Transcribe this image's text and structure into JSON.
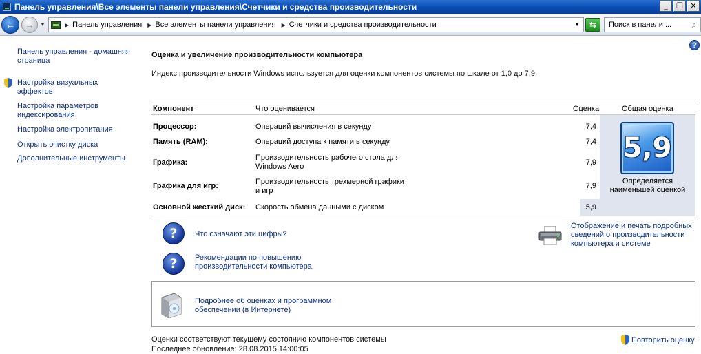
{
  "window": {
    "title": "Панель управления\\Все элементы панели управления\\Счетчики и средства производительности",
    "buttons": {
      "minimize": "_",
      "maximize": "❐",
      "close": "✕"
    }
  },
  "address": {
    "crumbs": [
      "Панель управления",
      "Все элементы панели управления",
      "Счетчики и средства производительности"
    ],
    "search_placeholder": "Поиск в панели ..."
  },
  "sidebar": {
    "items": [
      {
        "label": "Панель управления - домашняя страница",
        "shield": false
      },
      {
        "label": "Настройка визуальных эффектов",
        "shield": true
      },
      {
        "label": "Настройка параметров индексирования",
        "shield": false
      },
      {
        "label": "Настройка электропитания",
        "shield": false
      },
      {
        "label": "Открыть очистку диска",
        "shield": false
      },
      {
        "label": "Дополнительные инструменты",
        "shield": false
      }
    ]
  },
  "main": {
    "title": "Оценка и увеличение производительности компьютера",
    "intro": "Индекс производительности Windows используется для оценки компонентов системы по шкале от 1,0 до 7,9.",
    "table": {
      "headers": {
        "component": "Компонент",
        "what": "Что оценивается",
        "score": "Оценка",
        "base": "Общая оценка"
      },
      "rows": [
        {
          "component": "Процессор:",
          "what": "Операций вычисления в секунду",
          "score": "7,4"
        },
        {
          "component": "Память (RAM):",
          "what": "Операций доступа к памяти в секунду",
          "score": "7,4"
        },
        {
          "component": "Графика:",
          "what": "Производительность рабочего стола для Windows Aero",
          "score": "7,9"
        },
        {
          "component": "Графика для игр:",
          "what": "Производительность трехмерной графики и игр",
          "score": "7,9"
        },
        {
          "component": "Основной жесткий диск:",
          "what": "Скорость обмена данными с диском",
          "score": "5,9"
        }
      ],
      "base_score": "5,9",
      "base_caption": "Определяется наименьшей оценкой"
    },
    "links": {
      "what_numbers": "Что означают эти цифры?",
      "recommendations": "Рекомендации по повышению производительности компьютера.",
      "print_details": "Отображение и печать подробных сведений о производительности компьютера и системе",
      "more_online": "Подробнее об оценках и программном обеспечении (в Интернете)"
    },
    "footer": {
      "status": "Оценки соответствуют текущему состоянию компонентов системы",
      "last_update": "Последнее обновление: 28.08.2015 14:00:05",
      "rerate": "Повторить оценку"
    }
  },
  "colors": {
    "link": "#0c3087",
    "panel": "#dfe4ee",
    "titlebar": "#0a4fb5"
  }
}
